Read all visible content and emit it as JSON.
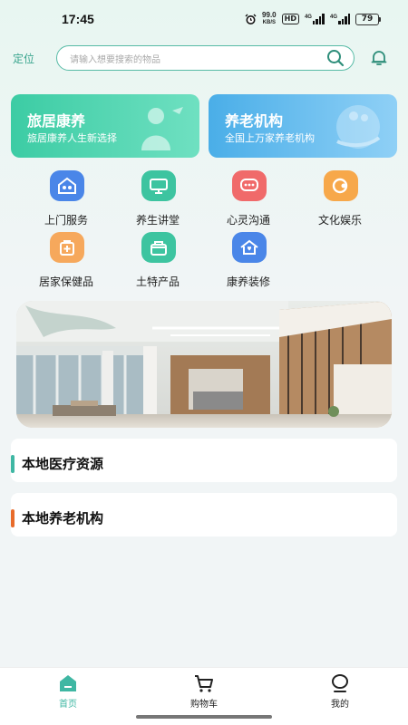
{
  "status_bar": {
    "time": "17:45",
    "net_speed": "99.0",
    "net_unit": "KB/S",
    "hd": "HD",
    "sig1": "4G",
    "sig2": "4G",
    "battery": "79"
  },
  "header": {
    "locate": "定位",
    "search_placeholder": "请输入想要搜索的物品"
  },
  "banners": [
    {
      "title": "旅居康养",
      "subtitle": "旅居康养人生新选择"
    },
    {
      "title": "养老机构",
      "subtitle": "全国上万家养老机构"
    }
  ],
  "grid": [
    {
      "label": "上门服务",
      "icon": "home-service-icon",
      "color": "#4a86e8"
    },
    {
      "label": "养生讲堂",
      "icon": "lecture-icon",
      "color": "#3dc4a0"
    },
    {
      "label": "心灵沟通",
      "icon": "chat-icon",
      "color": "#f06a6a"
    },
    {
      "label": "文化娱乐",
      "icon": "culture-icon",
      "color": "#f7a84a"
    },
    {
      "label": "居家保健品",
      "icon": "health-product-icon",
      "color": "#f6a85c"
    },
    {
      "label": "土特产品",
      "icon": "specialty-icon",
      "color": "#3dc4a0"
    },
    {
      "label": "康养装修",
      "icon": "renovation-icon",
      "color": "#4a86e8"
    }
  ],
  "sections": [
    {
      "title": "本地医疗资源",
      "accent": "#3fb7a3"
    },
    {
      "title": "本地养老机构",
      "accent": "#e86b2a"
    }
  ],
  "tabbar": [
    {
      "label": "首页",
      "icon": "home-icon",
      "active": true
    },
    {
      "label": "购物车",
      "icon": "cart-icon",
      "active": false
    },
    {
      "label": "我的",
      "icon": "profile-icon",
      "active": false
    }
  ],
  "colors": {
    "accent": "#3aa58e",
    "active_tab": "#3fb7a3"
  }
}
